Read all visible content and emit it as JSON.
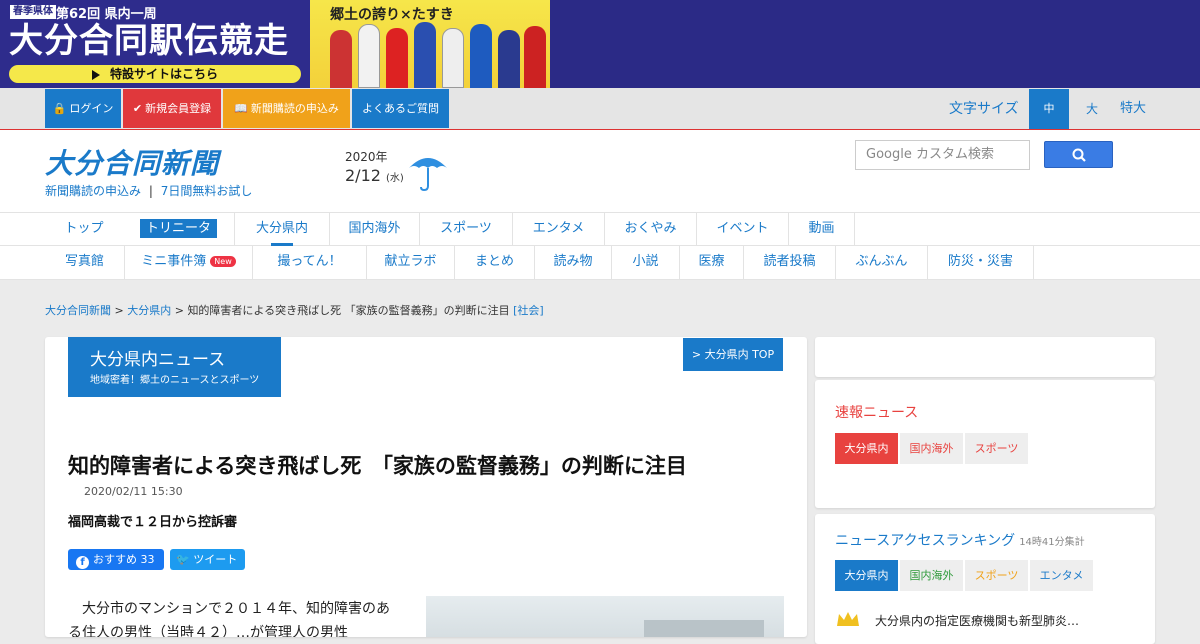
{
  "banner": {
    "tag": "春季県体",
    "edition": "第62回 県内一周",
    "title": "大分合同駅伝競走",
    "link_label": "特設サイトはこちら",
    "slogan": "郷土の誇り×たすき"
  },
  "topbar": {
    "login": "ログイン",
    "register": "新規会員登録",
    "subscribe": "新聞購読の申込み",
    "faq": "よくあるご質問",
    "fontsize_label": "文字サイズ",
    "fs_mid": "中",
    "fs_large": "大",
    "fs_xlarge": "特大"
  },
  "header": {
    "logo": "大分合同新聞",
    "sub_subscribe": "新聞購読の申込み",
    "sub_sep": "|",
    "sub_trial": "7日間無料お試し",
    "year": "2020年",
    "day": "2/12",
    "weekday": "(水)",
    "search_placeholder": "Google カスタム検索"
  },
  "nav1": [
    "トップ",
    "トリニータ",
    "大分県内",
    "国内海外",
    "スポーツ",
    "エンタメ",
    "おくやみ",
    "イベント",
    "動画"
  ],
  "nav2": [
    "写真館",
    "ミニ事件簿",
    "撮ってん！",
    "献立ラボ",
    "まとめ",
    "読み物",
    "小説",
    "医療",
    "読者投稿",
    "ぶんぶん",
    "防災・災害"
  ],
  "new_badge": "New",
  "breadcrumb": {
    "home": "大分合同新聞",
    "sep": " > ",
    "section": "大分県内",
    "article": "知的障害者による突き飛ばし死 「家族の監督義務」の判断に注目",
    "category": "[社会]"
  },
  "section_head": {
    "title": "大分県内ニュース",
    "subtitle": "地域密着！郷土のニュースとスポーツ",
    "top_link": "> 大分県内 TOP"
  },
  "article": {
    "headline": "知的障害者による突き飛ばし死　「家族の監督義務」の判断に注目",
    "date": "2020/02/11 15:30",
    "subhead": "福岡高裁で１２日から控訴審",
    "fb_label": "おすすめ",
    "fb_count": "33",
    "tw_label": "ツイート",
    "body": "大分市のマンションで２０１４年、知的障害のある住人の男性（当時４２）…が管理人の男性"
  },
  "side": {
    "breaking_title": "速報ニュース",
    "breaking_tabs": [
      "大分県内",
      "国内海外",
      "スポーツ"
    ],
    "ranking_title": "ニュースアクセスランキング",
    "ranking_note": "14時41分集計",
    "ranking_tabs": [
      "大分県内",
      "国内海外",
      "スポーツ",
      "エンタメ"
    ],
    "ranking_first": "大分県内の指定医療機関も新型肺炎…"
  },
  "colors": {
    "brand_blue": "#1a7ac9",
    "login_blue": "#1a7ac9",
    "register_red": "#e0383c",
    "subscribe_orange": "#f0a21a",
    "breaking_red": "#e8423f"
  }
}
